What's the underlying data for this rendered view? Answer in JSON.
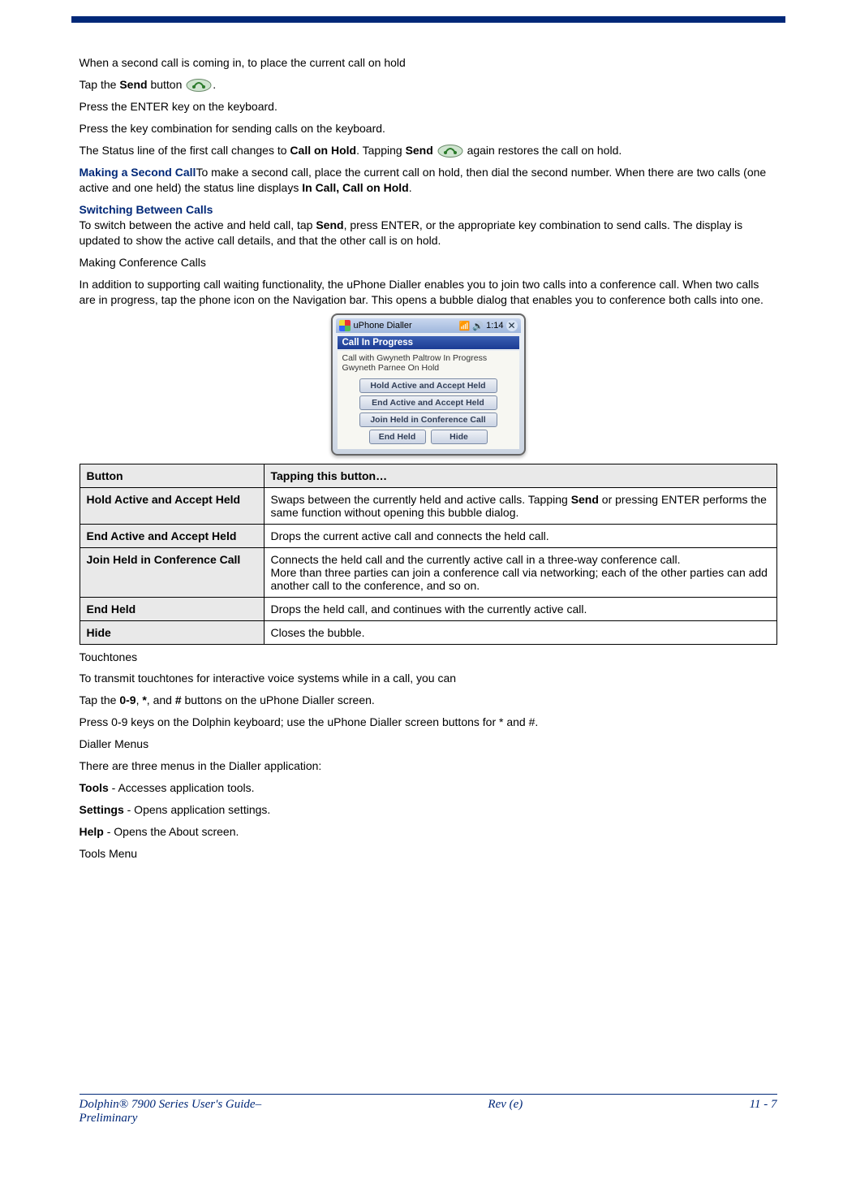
{
  "intro": "When a second call is coming in, to place the current call on hold",
  "tap_send_1": "Tap the ",
  "tap_send_2": "Send",
  "tap_send_3": " button ",
  "tap_send_4": ".",
  "press_enter": "Press the ENTER key on the keyboard.",
  "press_combo": "Press the key combination for sending calls on the keyboard.",
  "status_line_1": "The Status line of the first call changes to ",
  "status_line_2": "Call on Hold",
  "status_line_3": ". Tapping ",
  "status_line_4": "Send",
  "status_line_5": " again restores the call on hold.",
  "making_second_h": "Making a Second Call",
  "making_second_1": "To make a second call, place the current call on hold, then dial the second number. When there are two calls (one active and one held) the status line displays ",
  "making_second_2": "In Call, Call on Hold",
  "making_second_3": ".",
  "switching_h": "Switching Between Calls",
  "switching_1": "To switch between the active and held call, tap ",
  "switching_2": "Send",
  "switching_3": ", press ENTER, or the appropriate key combination to send calls. The display is updated to show the active call details, and that the other call is on hold.",
  "conf_title": "Making Conference Calls",
  "conf_body": "In addition to supporting call waiting functionality, the uPhone Dialler enables you to join two calls into a conference call. When two calls are in progress, tap the phone icon on the Navigation bar. This opens a bubble dialog that enables you to conference both calls into one.",
  "pda": {
    "title": "uPhone Dialler",
    "time": "1:14",
    "banner": "Call In Progress",
    "status1": "Call with Gwyneth Paltrow In Progress",
    "status2": "Gwyneth Parnee On Hold",
    "btn1": "Hold Active and Accept Held",
    "btn2": "End Active and Accept Held",
    "btn3": "Join Held in Conference Call",
    "btn4": "End Held",
    "btn5": "Hide"
  },
  "table": {
    "h1": "Button",
    "h2": "Tapping this button…",
    "rows": [
      {
        "label": "Hold Active and Accept Held",
        "desc_parts": [
          "Swaps between the currently held and active calls. Tapping ",
          "Send",
          " or pressing ENTER performs the same function without opening this bubble dialog."
        ]
      },
      {
        "label": "End Active and Accept Held",
        "desc_parts": [
          "Drops the current active call and connects the held call."
        ]
      },
      {
        "label": "Join Held in Conference Call",
        "desc_parts": [
          "Connects the held call and the currently active call in a three-way conference call.",
          "More than three parties can join a conference call via networking; each of the other parties can add another call to the conference, and so on."
        ]
      },
      {
        "label": "End Held",
        "desc_parts": [
          "Drops the held call, and continues with the currently active call."
        ]
      },
      {
        "label": "Hide",
        "desc_parts": [
          "Closes the bubble."
        ]
      }
    ]
  },
  "touchtones_h": "Touchtones",
  "touchtones_1": "To transmit touchtones for interactive voice systems while in a call, you can",
  "tt_tap_1": "Tap the ",
  "tt_tap_2": "0-9",
  "tt_tap_3": ", ",
  "tt_tap_4": "*",
  "tt_tap_5": ", and ",
  "tt_tap_6": "#",
  "tt_tap_7": " buttons on the uPhone Dialler screen.",
  "tt_press": "Press 0-9 keys on the Dolphin keyboard; use the uPhone Dialler screen buttons for * and #.",
  "menus_h": "Dialler Menus",
  "menus_1": "There are three menus in the Dialler application:",
  "menu_tools_b": "Tools",
  "menu_tools_t": " - Accesses application tools.",
  "menu_settings_b": "Settings",
  "menu_settings_t": " - Opens application settings.",
  "menu_help_b": "Help",
  "menu_help_t": " - Opens the About screen.",
  "tools_menu_h": "Tools Menu",
  "footer": {
    "left1": "Dolphin® 7900 Series User's Guide–",
    "left2": "Preliminary",
    "center": "Rev (e)",
    "right": "11 - 7"
  }
}
